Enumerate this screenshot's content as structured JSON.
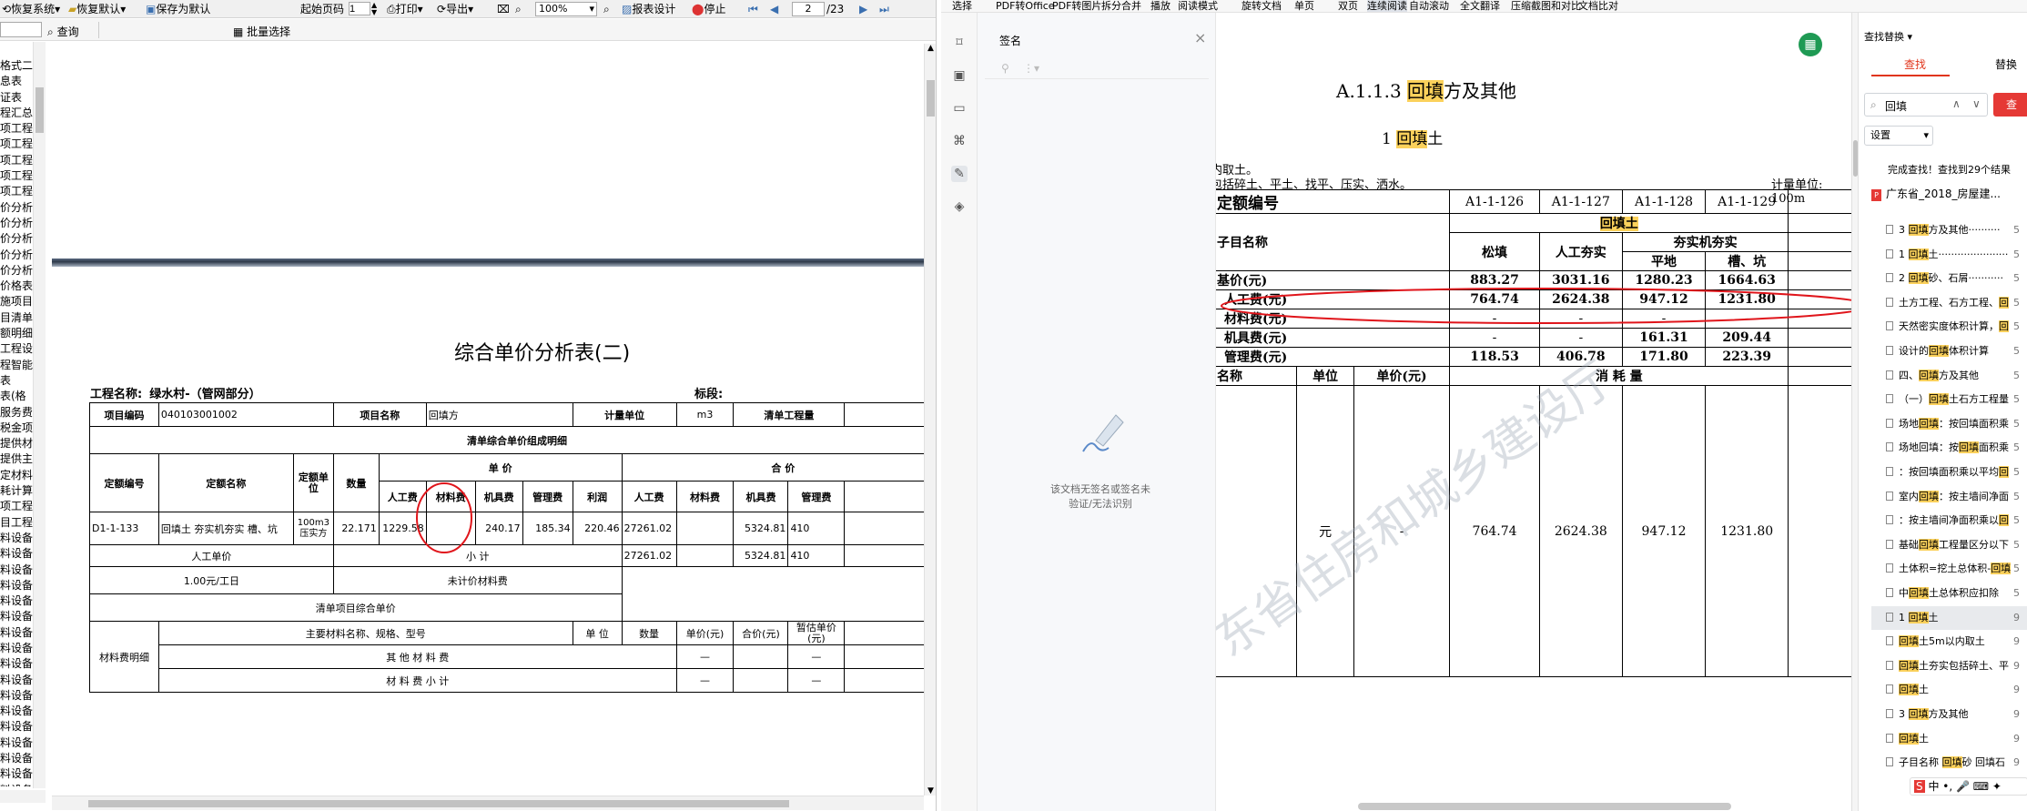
{
  "left": {
    "toolbar": {
      "restore_system": "恢复系统",
      "restore_default": "恢复默认",
      "save_default": "保存为默认",
      "start_page_label": "起始页码",
      "start_page_value": "1",
      "print": "打印",
      "export": "导出",
      "zoom": "100%",
      "report_design": "报表设计",
      "stop": "停止",
      "page_current": "2",
      "page_total": "/23"
    },
    "toolbar2": {
      "query": "查询",
      "batch_select": "批量选择"
    },
    "tree_items": [
      "格式二",
      "息表",
      "证表",
      "程汇总",
      "项工程",
      "项工程",
      "项工程",
      "项工程",
      "项工程",
      "价分析",
      "价分析",
      "价分析",
      "价分析",
      "价分析",
      "价格表",
      "施项目",
      "目清单",
      "额明细",
      "工程设",
      "程智能",
      "表",
      "表(格",
      "服务费",
      "税金项",
      "提供材",
      "提供主",
      "定材料",
      "耗计算",
      "项工程",
      "目工程",
      "料设备",
      "料设备",
      "料设备",
      "料设备",
      "料设备",
      "料设备",
      "料设备",
      "料设备",
      "料设备",
      "料设备",
      "料设备",
      "料设备",
      "料设备",
      "料设备",
      "料设备",
      "料设备",
      "料设备",
      "总"
    ],
    "report": {
      "title": "综合单价分析表(二)",
      "project_label": "工程名称:",
      "project_name": "绿水村-（管网部分）",
      "section_label": "标段:",
      "code_label": "项目编码",
      "code_value": "040103001002",
      "name_label": "项目名称",
      "name_value": "回填方",
      "unit_label": "计量单位",
      "unit_value": "m3",
      "qty_label": "清单工程量",
      "detail_header": "清单综合单价组成明细",
      "col_quota_code": "定额编号",
      "col_quota_name": "定额名称",
      "col_quota_unit": "定额单位",
      "col_qty": "数量",
      "col_unit_price": "单 价",
      "col_total_price": "合 价",
      "col_labor": "人工费",
      "col_material": "材料费",
      "col_machine": "机具费",
      "col_mgmt": "管理费",
      "col_profit": "利润",
      "row": {
        "code": "D1-1-133",
        "name": "回填土 夯实机夯实 槽、坑",
        "unit": "100m3压实方",
        "qty": "22.171",
        "labor": "1229.58",
        "material": "",
        "machine": "240.17",
        "mgmt": "185.34",
        "profit": "220.46",
        "t_labor": "27261.02",
        "t_material": "",
        "t_machine": "5324.81",
        "t_mgmt": "410"
      },
      "labor_unit_price": "人工单价",
      "subtotal": "小 计",
      "sub_labor": "27261.02",
      "sub_machine": "5324.81",
      "sub_mgmt": "410",
      "per_day": "1.00元/工日",
      "unpriced_material": "未计价材料费",
      "list_unit_price": "清单项目综合单价",
      "material_detail": "材料费明细",
      "main_material": "主要材料名称、规格、型号",
      "m_unit": "单 位",
      "m_qty": "数量",
      "m_unit_price": "单价(元)",
      "m_total": "合价(元)",
      "m_est": "暂估单价(元)",
      "other_material": "其 他 材 料 费",
      "material_subtotal": "材 料 费 小 计",
      "dash": "—"
    }
  },
  "right": {
    "toolbar": [
      "选择",
      "PDF转Office",
      "PDF转图片",
      "拆分合并",
      "播放",
      "阅读模式",
      "旋转文档",
      "单页",
      "双页",
      "连续阅读",
      "自动滚动",
      "全文翻译",
      "压缩",
      "截图和对比",
      "文档比对"
    ],
    "signature_panel": {
      "title": "签名",
      "empty_text_1": "该文档无签名或签名未",
      "empty_text_2": "验证/无法识别"
    },
    "doc": {
      "heading": "A.1.1.3 ",
      "heading_hl": "回填",
      "heading_rest": "方及其他",
      "sub_num": "1 ",
      "sub_hl": "回填",
      "sub_rest": "土",
      "note1": "内取土。",
      "note2": "包括碎土、平土、找平、压实、洒水。",
      "unit_note": "计量单位: 100m",
      "watermark": "东省住房和城乡建设厅",
      "r_code": "定额编号",
      "c1": "A1-1-126",
      "c2": "A1-1-127",
      "c3": "A1-1-128",
      "c4": "A1-1-129",
      "r_item": "子目名称",
      "grp_backfill": "回填土",
      "sub_loose": "松填",
      "sub_manual": "人工夯实",
      "sub_machine": "夯实机夯实",
      "sub_flat": "平地",
      "sub_trench": "槽、坑",
      "r_base": "基价(元)",
      "base": [
        "883.27",
        "3031.16",
        "1280.23",
        "1664.63"
      ],
      "r_labor": "人工费(元)",
      "labor": [
        "764.74",
        "2624.38",
        "947.12",
        "1231.80"
      ],
      "r_mat": "材料费(元)",
      "mat": [
        "-",
        "-",
        "-",
        "-"
      ],
      "r_mach": "机具费(元)",
      "mach": [
        "-",
        "-",
        "161.31",
        "209.44"
      ],
      "r_mgmt": "管理费(元)",
      "mgmt": [
        "118.53",
        "406.78",
        "171.80",
        "223.39"
      ],
      "r_name": "名称",
      "r_unit": "单位",
      "r_price": "单价(元)",
      "r_consume": "消 耗 量",
      "row_unit": "元",
      "row_price": "-",
      "row_vals": [
        "764.74",
        "2624.38",
        "947.12",
        "1231.80"
      ]
    },
    "search": {
      "header": "查找替换",
      "tab_find": "查找",
      "tab_replace": "替换",
      "query": "回填",
      "find_btn": "查",
      "settings": "设置",
      "status": "完成查找！查找到29个结果",
      "file": "广东省_2018_房屋建...",
      "results": [
        {
          "pre": "3 ",
          "hl": "回填",
          "post": "方及其他··········",
          "pg": "5"
        },
        {
          "pre": "1 ",
          "hl": "回填",
          "post": "土······················",
          "pg": "5"
        },
        {
          "pre": "2 ",
          "hl": "回填",
          "post": "砂、石屑···········",
          "pg": "5"
        },
        {
          "pre": "土方工程、石方工程、",
          "hl": "回",
          "post": "",
          "pg": "5"
        },
        {
          "pre": "天然密实度体积计算，",
          "hl": "回",
          "post": "",
          "pg": "5"
        },
        {
          "pre": "设计的",
          "hl": "回填",
          "post": "体积计算",
          "pg": "5"
        },
        {
          "pre": "四、",
          "hl": "回填",
          "post": "方及其他",
          "pg": "5"
        },
        {
          "pre": "（一）",
          "hl": "回填",
          "post": "土石方工程量",
          "pg": "5"
        },
        {
          "pre": "场地",
          "hl": "回填",
          "post": "：按回填面积乘",
          "pg": "5"
        },
        {
          "pre": "场地回填：按",
          "hl": "回填",
          "post": "面积乘",
          "pg": "5"
        },
        {
          "pre": "：按回填面积乘以平均",
          "hl": "回",
          "post": "",
          "pg": "5"
        },
        {
          "pre": "室内",
          "hl": "回填",
          "post": "：按主墙间净面",
          "pg": "5"
        },
        {
          "pre": "：按主墙间净面积乘以",
          "hl": "回",
          "post": "",
          "pg": "5"
        },
        {
          "pre": "基础",
          "hl": "回填",
          "post": "工程量区分以下",
          "pg": "5"
        },
        {
          "pre": "土体积=挖土总体积-",
          "hl": "回填",
          "post": "",
          "pg": "5"
        },
        {
          "pre": "中",
          "hl": "回填",
          "post": "土总体积应扣除",
          "pg": "5"
        },
        {
          "pre": "1 ",
          "hl": "回填",
          "post": "土",
          "pg": "9"
        },
        {
          "pre": "",
          "hl": "回填",
          "post": "土5m以内取土",
          "pg": "9"
        },
        {
          "pre": "",
          "hl": "回填",
          "post": "土夯实包括碎土、平",
          "pg": "9"
        },
        {
          "pre": "",
          "hl": "回填",
          "post": "土",
          "pg": "9"
        },
        {
          "pre": "3 ",
          "hl": "回填",
          "post": "方及其他",
          "pg": "9"
        },
        {
          "pre": "",
          "hl": "回填",
          "post": "土",
          "pg": "9"
        },
        {
          "pre": "子目名称 ",
          "hl": "回填",
          "post": "砂 回填石",
          "pg": "9"
        }
      ]
    }
  },
  "colors": {
    "highlight": "#fbd15b",
    "annotation": "#e0151b",
    "active_tab": "#e0351b",
    "pdf_red": "#e53935"
  }
}
